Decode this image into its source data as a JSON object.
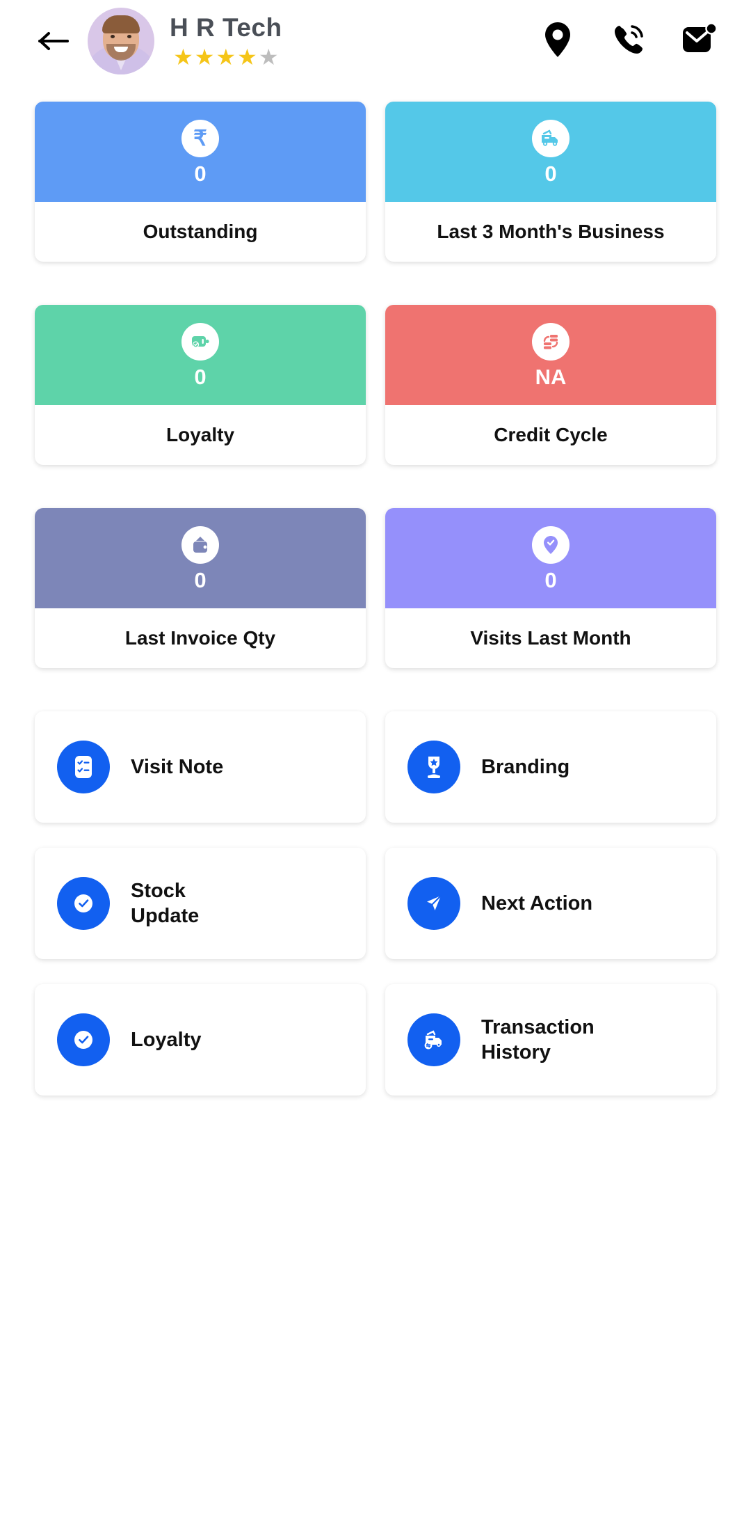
{
  "header": {
    "back_icon": "arrow-left-icon",
    "shop_name": "H R Tech",
    "rating": 4,
    "rating_max": 5,
    "avatar_alt": "shop-owner-avatar",
    "actions": [
      {
        "name": "location-pin-icon",
        "label": "Location"
      },
      {
        "name": "phone-call-icon",
        "label": "Call"
      },
      {
        "name": "message-mail-icon",
        "label": "Message",
        "badge": true
      }
    ]
  },
  "stat_cards": [
    {
      "label": "Outstanding",
      "value": "0",
      "icon": "rupee-icon",
      "color": "#5e9bf5"
    },
    {
      "label": "Last 3 Month's Business",
      "value": "0",
      "icon": "delivery-truck-icon",
      "color": "#54c8e8"
    },
    {
      "label": "Loyalty",
      "value": "0",
      "icon": "loyalty-card-icon",
      "color": "#5ed3a9"
    },
    {
      "label": "Credit Cycle",
      "value": "NA",
      "icon": "credit-cycle-icon",
      "color": "#ef7370"
    },
    {
      "label": "Last Invoice Qty",
      "value": "0",
      "icon": "wallet-icon",
      "color": "#7d86b8"
    },
    {
      "label": "Visits Last Month",
      "value": "0",
      "icon": "pin-check-icon",
      "color": "#9590fb"
    }
  ],
  "action_cards": [
    {
      "label": "Visit Note",
      "icon": "checklist-icon"
    },
    {
      "label": "Branding",
      "icon": "trophy-icon"
    },
    {
      "label": "Stock\nUpdate",
      "icon": "check-circle-icon"
    },
    {
      "label": "Next Action",
      "icon": "send-plane-icon"
    },
    {
      "label": "Loyalty",
      "icon": "check-circle-icon"
    },
    {
      "label": "Transaction\nHistory",
      "icon": "transaction-truck-icon"
    }
  ],
  "theme": {
    "accent": "#1260f0",
    "star_on": "#f5c518",
    "star_off": "#bdbdbd",
    "background": "#ffffff"
  }
}
